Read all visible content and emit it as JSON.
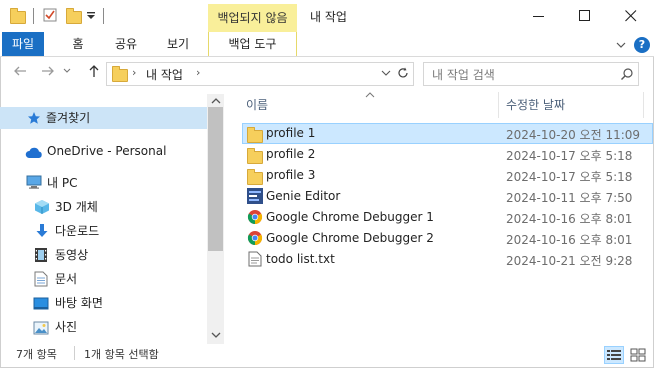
{
  "window": {
    "title": "내 작업",
    "context_tab": "백업되지 않음"
  },
  "ribbon": {
    "tabs": [
      "파일",
      "홈",
      "공유",
      "보기",
      "백업 도구"
    ]
  },
  "address": {
    "path": "내 작업",
    "search_placeholder": "내 작업 검색"
  },
  "nav_pane": {
    "items": [
      {
        "label": "즐겨찾기",
        "icon": "star-icon",
        "selected": true
      },
      {
        "label": "OneDrive - Personal",
        "icon": "cloud-icon"
      },
      {
        "label": "내 PC",
        "icon": "computer-icon"
      },
      {
        "label": "3D 개체",
        "icon": "cube-icon"
      },
      {
        "label": "다운로드",
        "icon": "download-arrow-icon"
      },
      {
        "label": "동영상",
        "icon": "film-icon"
      },
      {
        "label": "문서",
        "icon": "document-icon"
      },
      {
        "label": "바탕 화면",
        "icon": "desktop-icon"
      },
      {
        "label": "사진",
        "icon": "picture-icon"
      }
    ]
  },
  "file_list": {
    "columns": [
      "이름",
      "수정한 날짜"
    ],
    "rows": [
      {
        "name": "profile 1",
        "date": "2024-10-20 오전 11:09",
        "icon": "folder-icon",
        "selected": true
      },
      {
        "name": "profile 2",
        "date": "2024-10-17 오후 5:18",
        "icon": "folder-icon"
      },
      {
        "name": "profile 3",
        "date": "2024-10-17 오후 5:18",
        "icon": "folder-icon"
      },
      {
        "name": "Genie Editor",
        "date": "2024-10-11 오후 7:50",
        "icon": "genie-app-icon"
      },
      {
        "name": "Google Chrome Debugger 1",
        "date": "2024-10-16 오후 8:01",
        "icon": "chrome-icon"
      },
      {
        "name": "Google Chrome Debugger 2",
        "date": "2024-10-16 오후 8:01",
        "icon": "chrome-icon"
      },
      {
        "name": "todo list.txt",
        "date": "2024-10-21 오전 9:28",
        "icon": "text-file-icon"
      }
    ]
  },
  "status": {
    "item_count": "7개 항목",
    "selected": "1개 항목 선택함"
  }
}
